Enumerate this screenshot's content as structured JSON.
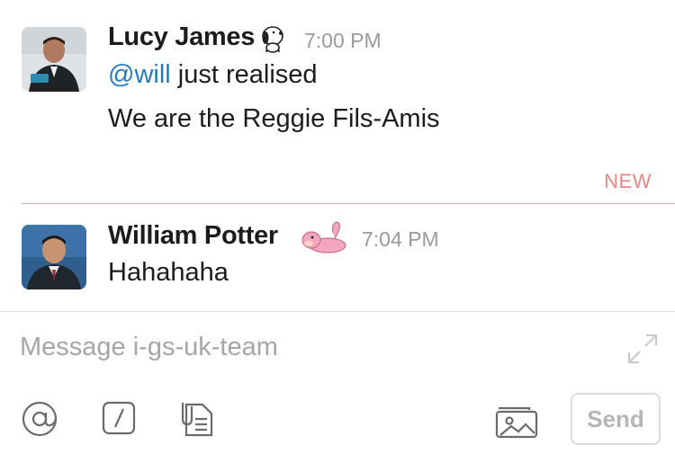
{
  "messages": [
    {
      "sender": "Lucy James",
      "time": "7:00 PM",
      "emoji_icon": "snoopy-icon",
      "mention": "@will",
      "line1_rest": " just realised",
      "line2": "We are the Reggie Fils-Amis"
    },
    {
      "sender": "William Potter",
      "time": "7:04 PM",
      "emoji_icon": "slowpoke-icon",
      "line1": "Hahahaha"
    }
  ],
  "new_divider": {
    "label": "NEW"
  },
  "composer": {
    "placeholder": "Message i-gs-uk-team",
    "send_label": "Send",
    "tools": [
      "at-sign-icon",
      "slash-command-icon",
      "file-attach-icon",
      "photos-icon"
    ]
  },
  "colors": {
    "mention": "#2a7ab8",
    "new_accent": "#e98585",
    "muted": "#9a9a9a"
  }
}
